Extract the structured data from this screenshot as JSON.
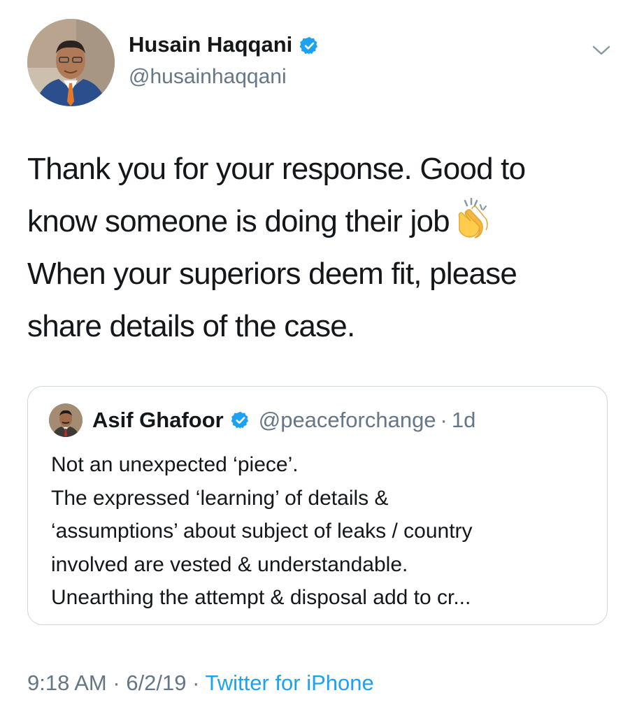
{
  "tweet": {
    "author": {
      "name": "Husain Haqqani",
      "handle": "@husainhaqqani",
      "verified": true
    },
    "text_lines": [
      "Thank you for your response. Good to",
      "know someone is doing their job",
      "When your superiors deem fit, please",
      "share details of the case."
    ],
    "emoji": "clapping-hands",
    "quoted": {
      "author_name": "Asif Ghafoor",
      "handle": "@peaceforchange",
      "time": "1d",
      "separator": "·",
      "verified": true,
      "text_lines": [
        "Not an unexpected ‘piece’.",
        "The expressed ‘learning’ of details &",
        "‘assumptions’ about subject of leaks / country",
        "involved are vested & understandable.",
        "Unearthing the attempt & disposal add to cr..."
      ]
    },
    "footer": {
      "time": "9:18 AM",
      "separator": "·",
      "date": "6/2/19",
      "source": "Twitter for iPhone"
    }
  },
  "colors": {
    "text": "#14171a",
    "secondary": "#657786",
    "link": "#1da1f2",
    "verified": "#1da1f2",
    "border": "#ccd6dd"
  }
}
